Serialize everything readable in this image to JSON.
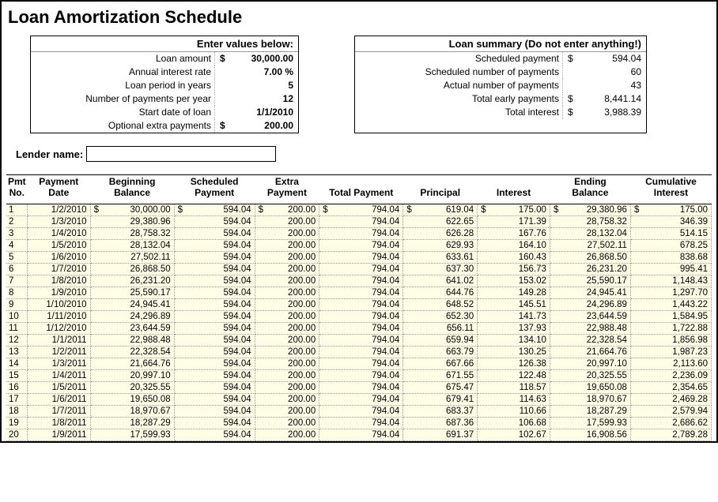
{
  "title": "Loan Amortization Schedule",
  "input_box": {
    "header": "Enter values below:",
    "rows": [
      {
        "label": "Loan amount",
        "currency": "$",
        "value": "30,000.00"
      },
      {
        "label": "Annual interest rate",
        "currency": "",
        "value": "7.00  %"
      },
      {
        "label": "Loan period in years",
        "currency": "",
        "value": "5"
      },
      {
        "label": "Number of payments per year",
        "currency": "",
        "value": "12"
      },
      {
        "label": "Start date of loan",
        "currency": "",
        "value": "1/1/2010"
      },
      {
        "label": "Optional extra payments",
        "currency": "$",
        "value": "200.00"
      }
    ]
  },
  "summary_box": {
    "header": "Loan summary (Do not enter anything!)",
    "rows": [
      {
        "label": "Scheduled payment",
        "currency": "$",
        "value": "594.04"
      },
      {
        "label": "Scheduled number of payments",
        "currency": "",
        "value": "60"
      },
      {
        "label": "Actual number of payments",
        "currency": "",
        "value": "43"
      },
      {
        "label": "Total early payments",
        "currency": "$",
        "value": "8,441.14"
      },
      {
        "label": "Total interest",
        "currency": "$",
        "value": "3,988.39"
      }
    ]
  },
  "lender": {
    "label": "Lender name:",
    "value": ""
  },
  "columns": [
    "Pmt No.",
    "Payment Date",
    "Beginning Balance",
    "Scheduled Payment",
    "Extra Payment",
    "Total Payment",
    "Principal",
    "Interest",
    "Ending Balance",
    "Cumulative Interest"
  ],
  "rows": [
    {
      "no": "1",
      "date": "1/2/2010",
      "bbal": "30,000.00",
      "sch": "594.04",
      "extra": "200.00",
      "total": "794.04",
      "prin": "619.04",
      "int": "175.00",
      "ebal": "29,380.96",
      "cum": "175.00",
      "first": true
    },
    {
      "no": "2",
      "date": "1/3/2010",
      "bbal": "29,380.96",
      "sch": "594.04",
      "extra": "200.00",
      "total": "794.04",
      "prin": "622.65",
      "int": "171.39",
      "ebal": "28,758.32",
      "cum": "346.39"
    },
    {
      "no": "3",
      "date": "1/4/2010",
      "bbal": "28,758.32",
      "sch": "594.04",
      "extra": "200.00",
      "total": "794.04",
      "prin": "626.28",
      "int": "167.76",
      "ebal": "28,132.04",
      "cum": "514.15"
    },
    {
      "no": "4",
      "date": "1/5/2010",
      "bbal": "28,132.04",
      "sch": "594.04",
      "extra": "200.00",
      "total": "794.04",
      "prin": "629.93",
      "int": "164.10",
      "ebal": "27,502.11",
      "cum": "678.25"
    },
    {
      "no": "5",
      "date": "1/6/2010",
      "bbal": "27,502.11",
      "sch": "594.04",
      "extra": "200.00",
      "total": "794.04",
      "prin": "633.61",
      "int": "160.43",
      "ebal": "26,868.50",
      "cum": "838.68"
    },
    {
      "no": "6",
      "date": "1/7/2010",
      "bbal": "26,868.50",
      "sch": "594.04",
      "extra": "200.00",
      "total": "794.04",
      "prin": "637.30",
      "int": "156.73",
      "ebal": "26,231.20",
      "cum": "995.41"
    },
    {
      "no": "7",
      "date": "1/8/2010",
      "bbal": "26,231.20",
      "sch": "594.04",
      "extra": "200.00",
      "total": "794.04",
      "prin": "641.02",
      "int": "153.02",
      "ebal": "25,590.17",
      "cum": "1,148.43"
    },
    {
      "no": "8",
      "date": "1/9/2010",
      "bbal": "25,590.17",
      "sch": "594.04",
      "extra": "200.00",
      "total": "794.04",
      "prin": "644.76",
      "int": "149.28",
      "ebal": "24,945.41",
      "cum": "1,297.70"
    },
    {
      "no": "9",
      "date": "1/10/2010",
      "bbal": "24,945.41",
      "sch": "594.04",
      "extra": "200.00",
      "total": "794.04",
      "prin": "648.52",
      "int": "145.51",
      "ebal": "24,296.89",
      "cum": "1,443.22"
    },
    {
      "no": "10",
      "date": "1/11/2010",
      "bbal": "24,296.89",
      "sch": "594.04",
      "extra": "200.00",
      "total": "794.04",
      "prin": "652.30",
      "int": "141.73",
      "ebal": "23,644.59",
      "cum": "1,584.95"
    },
    {
      "no": "11",
      "date": "1/12/2010",
      "bbal": "23,644.59",
      "sch": "594.04",
      "extra": "200.00",
      "total": "794.04",
      "prin": "656.11",
      "int": "137.93",
      "ebal": "22,988.48",
      "cum": "1,722.88"
    },
    {
      "no": "12",
      "date": "1/1/2011",
      "bbal": "22,988.48",
      "sch": "594.04",
      "extra": "200.00",
      "total": "794.04",
      "prin": "659.94",
      "int": "134.10",
      "ebal": "22,328.54",
      "cum": "1,856.98"
    },
    {
      "no": "13",
      "date": "1/2/2011",
      "bbal": "22,328.54",
      "sch": "594.04",
      "extra": "200.00",
      "total": "794.04",
      "prin": "663.79",
      "int": "130.25",
      "ebal": "21,664.76",
      "cum": "1,987.23"
    },
    {
      "no": "14",
      "date": "1/3/2011",
      "bbal": "21,664.76",
      "sch": "594.04",
      "extra": "200.00",
      "total": "794.04",
      "prin": "667.66",
      "int": "126.38",
      "ebal": "20,997.10",
      "cum": "2,113.60"
    },
    {
      "no": "15",
      "date": "1/4/2011",
      "bbal": "20,997.10",
      "sch": "594.04",
      "extra": "200.00",
      "total": "794.04",
      "prin": "671.55",
      "int": "122.48",
      "ebal": "20,325.55",
      "cum": "2,236.09"
    },
    {
      "no": "16",
      "date": "1/5/2011",
      "bbal": "20,325.55",
      "sch": "594.04",
      "extra": "200.00",
      "total": "794.04",
      "prin": "675.47",
      "int": "118.57",
      "ebal": "19,650.08",
      "cum": "2,354.65"
    },
    {
      "no": "17",
      "date": "1/6/2011",
      "bbal": "19,650.08",
      "sch": "594.04",
      "extra": "200.00",
      "total": "794.04",
      "prin": "679.41",
      "int": "114.63",
      "ebal": "18,970.67",
      "cum": "2,469.28"
    },
    {
      "no": "18",
      "date": "1/7/2011",
      "bbal": "18,970.67",
      "sch": "594.04",
      "extra": "200.00",
      "total": "794.04",
      "prin": "683.37",
      "int": "110.66",
      "ebal": "18,287.29",
      "cum": "2,579.94"
    },
    {
      "no": "19",
      "date": "1/8/2011",
      "bbal": "18,287.29",
      "sch": "594.04",
      "extra": "200.00",
      "total": "794.04",
      "prin": "687.36",
      "int": "106.68",
      "ebal": "17,599.93",
      "cum": "2,686.62"
    },
    {
      "no": "20",
      "date": "1/9/2011",
      "bbal": "17,599.93",
      "sch": "594.04",
      "extra": "200.00",
      "total": "794.04",
      "prin": "691.37",
      "int": "102.67",
      "ebal": "16,908.56",
      "cum": "2,789.28"
    }
  ]
}
